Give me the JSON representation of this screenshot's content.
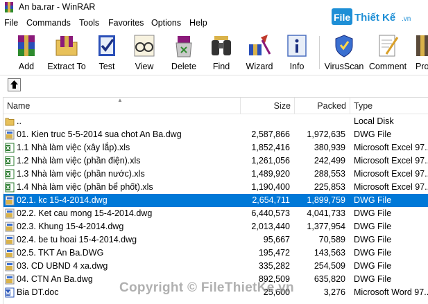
{
  "window": {
    "title": "An ba.rar - WinRAR"
  },
  "watermark": {
    "logo_text": "FileThiết Kế.vn",
    "copyright": "Copyright © FileThietKe.vn"
  },
  "menu": [
    "File",
    "Commands",
    "Tools",
    "Favorites",
    "Options",
    "Help"
  ],
  "toolbar": [
    {
      "label": "Add",
      "icon": "add-archive-icon"
    },
    {
      "label": "Extract To",
      "icon": "extract-folder-icon"
    },
    {
      "label": "Test",
      "icon": "test-checkmark-icon"
    },
    {
      "label": "View",
      "icon": "view-glasses-icon"
    },
    {
      "label": "Delete",
      "icon": "delete-recycle-icon"
    },
    {
      "label": "Find",
      "icon": "find-binoculars-icon"
    },
    {
      "label": "Wizard",
      "icon": "wizard-icon"
    },
    {
      "label": "Info",
      "icon": "info-icon"
    },
    {
      "label": "VirusScan",
      "icon": "virusscan-icon"
    },
    {
      "label": "Comment",
      "icon": "comment-icon"
    },
    {
      "label": "Pro",
      "icon": "protect-icon"
    }
  ],
  "columns": {
    "name": "Name",
    "size": "Size",
    "packed": "Packed",
    "type": "Type"
  },
  "files": [
    {
      "name": "..",
      "size": "",
      "packed": "",
      "type": "Local Disk",
      "icon": "folder"
    },
    {
      "name": "01. Kien truc 5-5-2014 sua chot An Ba.dwg",
      "size": "2,587,866",
      "packed": "1,972,635",
      "type": "DWG File",
      "icon": "dwg"
    },
    {
      "name": "1.1 Nhà làm việc (xây lắp).xls",
      "size": "1,852,416",
      "packed": "380,939",
      "type": "Microsoft Excel 97...",
      "icon": "xls"
    },
    {
      "name": "1.2 Nhà làm việc (phần điện).xls",
      "size": "1,261,056",
      "packed": "242,499",
      "type": "Microsoft Excel 97...",
      "icon": "xls"
    },
    {
      "name": "1.3 Nhà làm việc (phần nước).xls",
      "size": "1,489,920",
      "packed": "288,553",
      "type": "Microsoft Excel 97...",
      "icon": "xls"
    },
    {
      "name": "1.4 Nhà làm việc (phần bể phốt).xls",
      "size": "1,190,400",
      "packed": "225,853",
      "type": "Microsoft Excel 97...",
      "icon": "xls"
    },
    {
      "name": "02.1. kc 15-4-2014.dwg",
      "size": "2,654,711",
      "packed": "1,899,759",
      "type": "DWG File",
      "icon": "dwg",
      "selected": true
    },
    {
      "name": "02.2. Ket cau mong  15-4-2014.dwg",
      "size": "6,440,573",
      "packed": "4,041,733",
      "type": "DWG File",
      "icon": "dwg"
    },
    {
      "name": "02.3. Khung 15-4-2014.dwg",
      "size": "2,013,440",
      "packed": "1,377,954",
      "type": "DWG File",
      "icon": "dwg"
    },
    {
      "name": "02.4. be tu hoai 15-4-2014.dwg",
      "size": "95,667",
      "packed": "70,589",
      "type": "DWG File",
      "icon": "dwg"
    },
    {
      "name": "02.5. TKT An Ba.DWG",
      "size": "195,472",
      "packed": "143,563",
      "type": "DWG File",
      "icon": "dwg"
    },
    {
      "name": "03. CD UBND 4 xa.dwg",
      "size": "335,282",
      "packed": "254,509",
      "type": "DWG File",
      "icon": "dwg"
    },
    {
      "name": "04. CTN An Ba.dwg",
      "size": "892,509",
      "packed": "635,820",
      "type": "DWG File",
      "icon": "dwg"
    },
    {
      "name": "Bia DT.doc",
      "size": "25,600",
      "packed": "3,276",
      "type": "Microsoft Word 97...",
      "icon": "doc"
    }
  ]
}
